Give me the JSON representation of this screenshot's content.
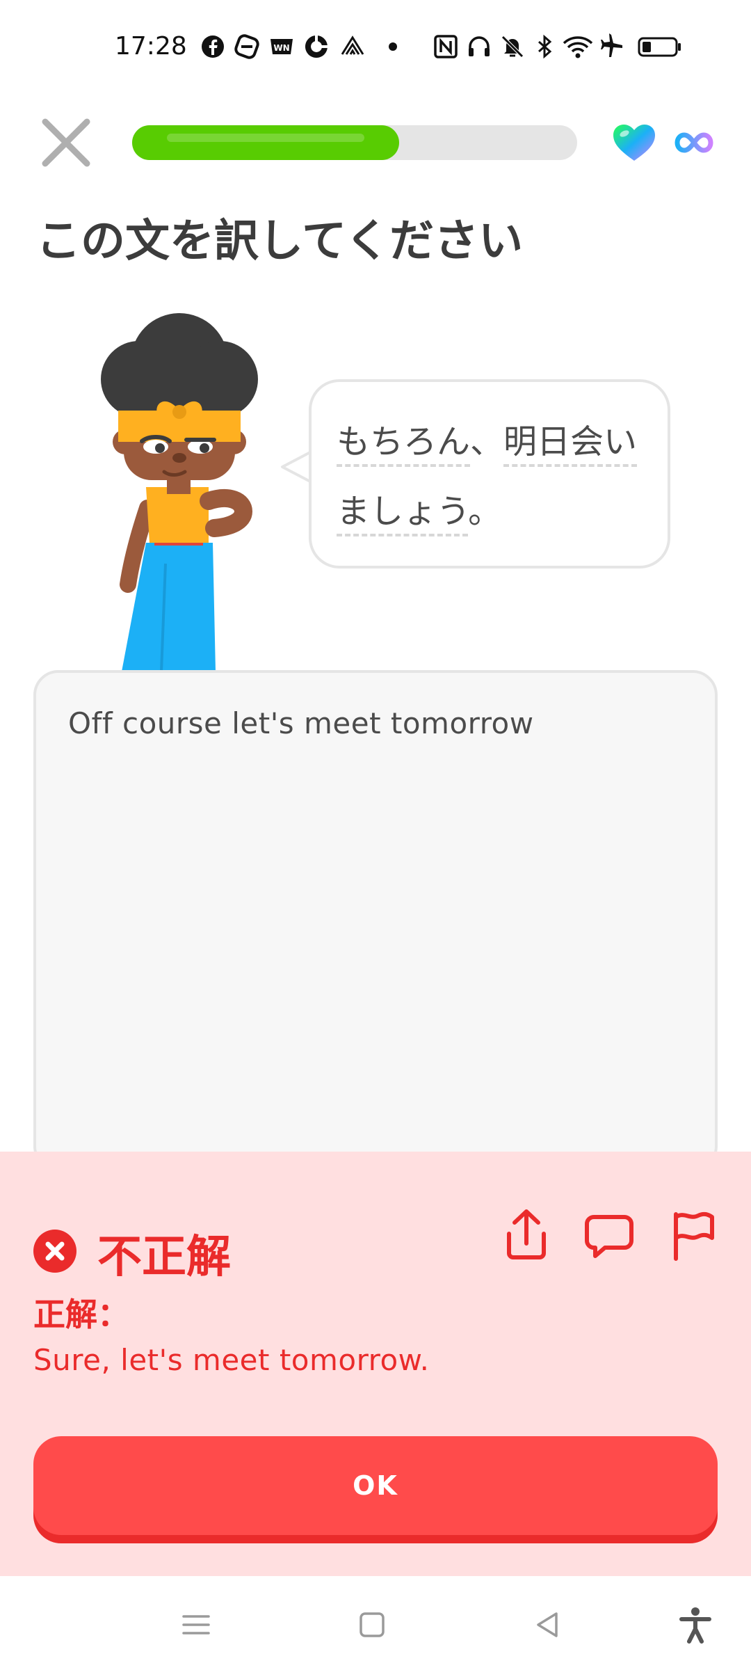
{
  "status_bar": {
    "time": "17:28",
    "left_icons": [
      "facebook-icon",
      "app-icon",
      "app-icon",
      "app-icon",
      "app-icon",
      "dot-icon"
    ],
    "right_icons": [
      "nfc-icon",
      "headphones-icon",
      "mute-icon",
      "bluetooth-icon",
      "wifi-icon",
      "airplane-icon",
      "battery-icon"
    ]
  },
  "header": {
    "progress": 0.6,
    "hearts": "heart-icon",
    "hearts_count": "infinity-icon"
  },
  "instruction": "この文を訳してください",
  "prompt": {
    "line1_words": [
      "もちろん",
      "、",
      "明日会い"
    ],
    "line2_words": [
      "ましょう",
      "。"
    ]
  },
  "answer": {
    "text": "Off course let's meet tomorrow"
  },
  "feedback": {
    "title": "不正解",
    "correct_label": "正解：",
    "correct_answer": "Sure, let's meet tomorrow.",
    "ok_label": "OK",
    "colors": {
      "background": "#ffdfe0",
      "accent": "#ea2b2b",
      "button": "#ff4b4b"
    }
  },
  "nav_bar": {
    "icons": [
      "menu-icon",
      "home-icon",
      "back-icon",
      "accessibility-icon"
    ]
  }
}
